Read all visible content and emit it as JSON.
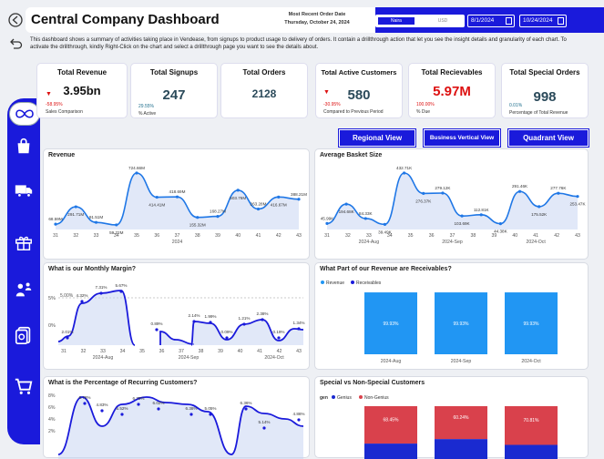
{
  "header": {
    "title": "Central Company Dashboard",
    "recent_label": "Most Recent Order Date",
    "recent_value": "Thursday, October 24, 2024",
    "currency_a": "Naira",
    "currency_b": "USD",
    "date_start": "8/1/2024",
    "date_end": "10/24/2024"
  },
  "description": "This dashboard shows a summary of activities taking place in Vendease, from signups to product usage to delivery of orders.  It contain a drillthrough action that let you see the insight  details and granularity of each chart. To activate the drillthrough, kindly Right-Click on the chart and select a drillthrough page you want to see the details about.",
  "kpis": [
    {
      "title": "Total Revenue",
      "value": "3.95bn",
      "sub_value": "-58.95%",
      "sub_label": "Sales Comparison"
    },
    {
      "title": "Total Signups",
      "value": "247",
      "sub_value": "29.55%",
      "sub_label": "% Active"
    },
    {
      "title": "Total Orders",
      "value": "2128"
    },
    {
      "title": "Total Active Customers",
      "value": "580",
      "sub_value": "-30.95%",
      "sub_label": "Compared to Previous Period"
    },
    {
      "title": "Total Recievables",
      "value": "5.97M",
      "sub_value": "100.00%",
      "sub_label": "% Due"
    },
    {
      "title": "Total Special Orders",
      "value": "998",
      "sub_value": "0.01%",
      "sub_label": "Percentage of Total Revenue"
    }
  ],
  "view_buttons": {
    "regional": "Regional View",
    "business": "Business Vertical View",
    "quadrant": "Quadrant View"
  },
  "colors": {
    "accent": "#1a1adb",
    "line": "#1f77e6",
    "fill": "#c9d6f3",
    "negative": "#d11111",
    "receivable": "#2196f3",
    "genius": "#1a2ad0",
    "non_genius": "#d9414c"
  },
  "icons": [
    "infinity-icon",
    "bag-icon",
    "truck-icon",
    "gift-icon",
    "people-icon",
    "money-icon",
    "cart-icon",
    "back-arrow-icon",
    "return-arrow-icon"
  ],
  "chart_data": [
    {
      "type": "line",
      "title": "Revenue",
      "x": [
        "31",
        "32",
        "33",
        "34",
        "35",
        "36",
        "37",
        "38",
        "39",
        "40",
        "41",
        "42",
        "43"
      ],
      "xgroup": "2024",
      "labels": [
        "68.59M",
        "291.71M",
        "91.51M",
        "59.22M",
        "724.66M",
        "414.41M",
        "418.69M",
        "155.32M",
        "168.27M",
        "503.76M",
        "263.28M",
        "416.67M",
        "388.21M"
      ],
      "values": [
        68.59,
        291.71,
        91.51,
        59.22,
        724.66,
        414.41,
        418.69,
        155.32,
        168.27,
        503.76,
        263.28,
        416.67,
        388.21
      ]
    },
    {
      "type": "line",
      "title": "Average Basket Size",
      "x": [
        "31",
        "32",
        "33",
        "34",
        "35",
        "36",
        "37",
        "38",
        "39",
        "40",
        "41",
        "42",
        "43"
      ],
      "xgroups": [
        "2024-Aug",
        "2024-Sep",
        "2024-Oct"
      ],
      "labels": [
        "45.99K",
        "194.68K",
        "84.33K",
        "39.49K",
        "432.71K",
        "276.37K",
        "279.12K",
        "103.69K",
        "112.81K",
        "44.38K",
        "291.46K",
        "175.52K",
        "277.76K",
        "253.47K"
      ],
      "values": [
        45.99,
        194.68,
        84.33,
        39.49,
        432.71,
        276.37,
        279.12,
        103.69,
        112.81,
        44.38,
        291.46,
        175.52,
        277.76,
        253.47
      ]
    },
    {
      "type": "line",
      "title": "What is our Monthly Margin?",
      "x": [
        "31",
        "32",
        "33",
        "34",
        "35",
        "36",
        "37",
        "38",
        "39",
        "40",
        "41",
        "42",
        "43"
      ],
      "xgroups": [
        "2024-Aug",
        "2024-Sep",
        "2024-Oct"
      ],
      "yticks": [
        "5%",
        "0%"
      ],
      "reference": "5.00%",
      "labels": [
        "2.01%",
        "4.32%",
        "7.31%",
        "5.67%",
        "0.89%",
        "2.14%",
        "1.99%",
        "0.09%",
        "1.21%",
        "2.38%",
        "0.19%",
        "1.34%"
      ]
    },
    {
      "type": "bar",
      "title": "What Part of our Revenue are Receivables?",
      "legend": [
        "Revenue",
        "Receivables"
      ],
      "categories": [
        "2024-Aug",
        "2024-Sep",
        "2024-Oct"
      ],
      "labels": [
        "99.93%",
        "99.93%",
        "99.93%"
      ],
      "values": [
        99.93,
        99.93,
        99.93
      ]
    },
    {
      "type": "line",
      "title": "What is the Percentage of Recurring Customers?",
      "yticks": [
        "8%",
        "6%",
        "4%",
        "2%"
      ],
      "labels": [
        "6.78%",
        "4.83%",
        "5.52%",
        "6.78%",
        "6.02%",
        "6.38%",
        "5.05%",
        "6.36%",
        "5.14%",
        "4.86%"
      ]
    },
    {
      "type": "bar",
      "title": "Special vs Non-Special Customers",
      "legend_title": "gen",
      "legend": [
        "Genius",
        "Non-Genius"
      ],
      "categories": [
        "2024-Aug",
        "2024-Sep",
        "2024-Oct"
      ],
      "labels": [
        "68.45%",
        "60.24%",
        "70.81%"
      ],
      "values": [
        68.45,
        60.24,
        70.81
      ]
    }
  ]
}
